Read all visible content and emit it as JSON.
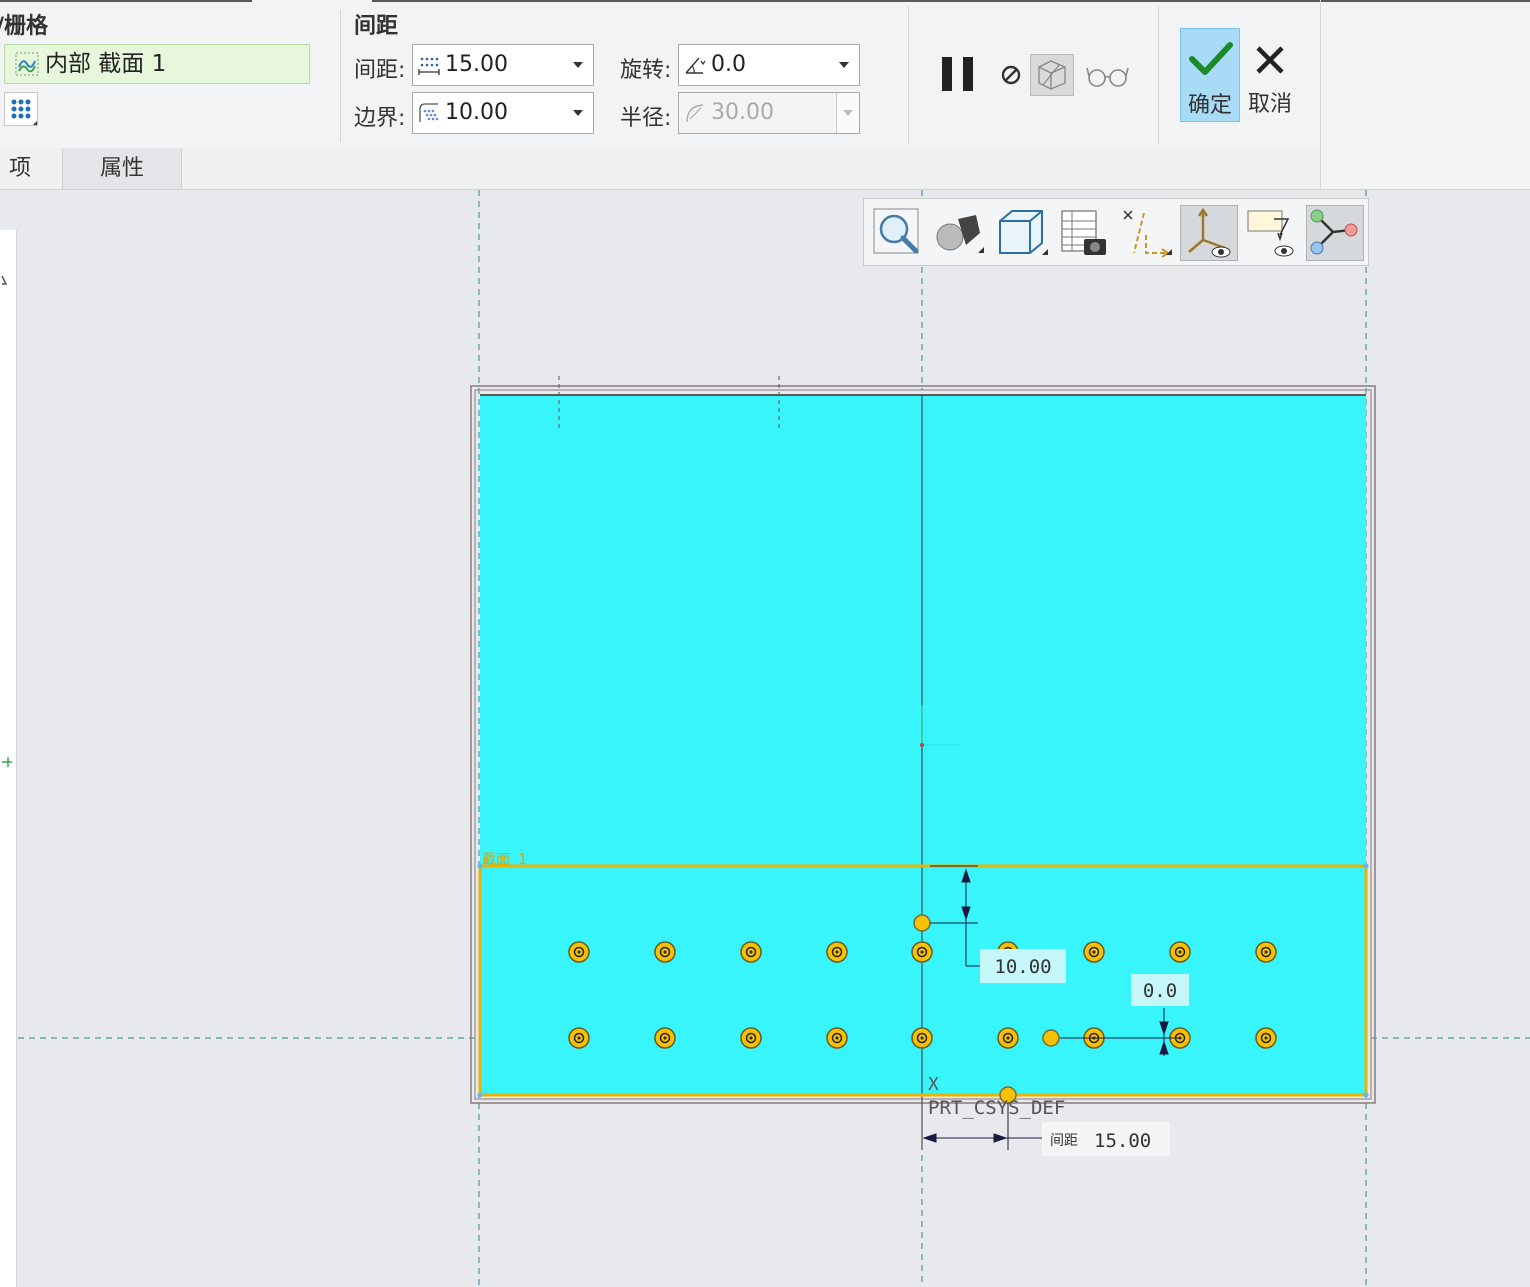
{
  "ribbon": {
    "group_pattern_title": "/栅格",
    "section_ref": "内部 截面 1",
    "group_spacing_title": "间距",
    "spacing_label": "间距:",
    "spacing_value": "15.00",
    "border_label": "边界:",
    "border_value": "10.00",
    "rotation_label": "旋转:",
    "rotation_value": "0.0",
    "radius_label": "半径:",
    "radius_value": "30.00",
    "ok_label": "确定",
    "cancel_label": "取消"
  },
  "tabs": [
    {
      "label": "项"
    },
    {
      "label": "属性"
    }
  ],
  "canvas": {
    "section_label": "截面 1",
    "dim_border": "10.00",
    "dim_rotation": "0.0",
    "dim_spacing_prefix": "间距",
    "dim_spacing": "15.00",
    "csys_axis": "X",
    "csys_name": "PRT_CSYS_DEF",
    "fill_color": "#38f4fb",
    "highlight_color": "#e8b400",
    "point_color": "#f7c000"
  },
  "view_toolbar": {
    "icons": [
      "zoom-icon",
      "appearance-icon",
      "display-style-icon",
      "saved-views-icon",
      "datum-display-icon",
      "csys-display-icon",
      "annotation-display-icon",
      "spin-center-icon"
    ]
  }
}
